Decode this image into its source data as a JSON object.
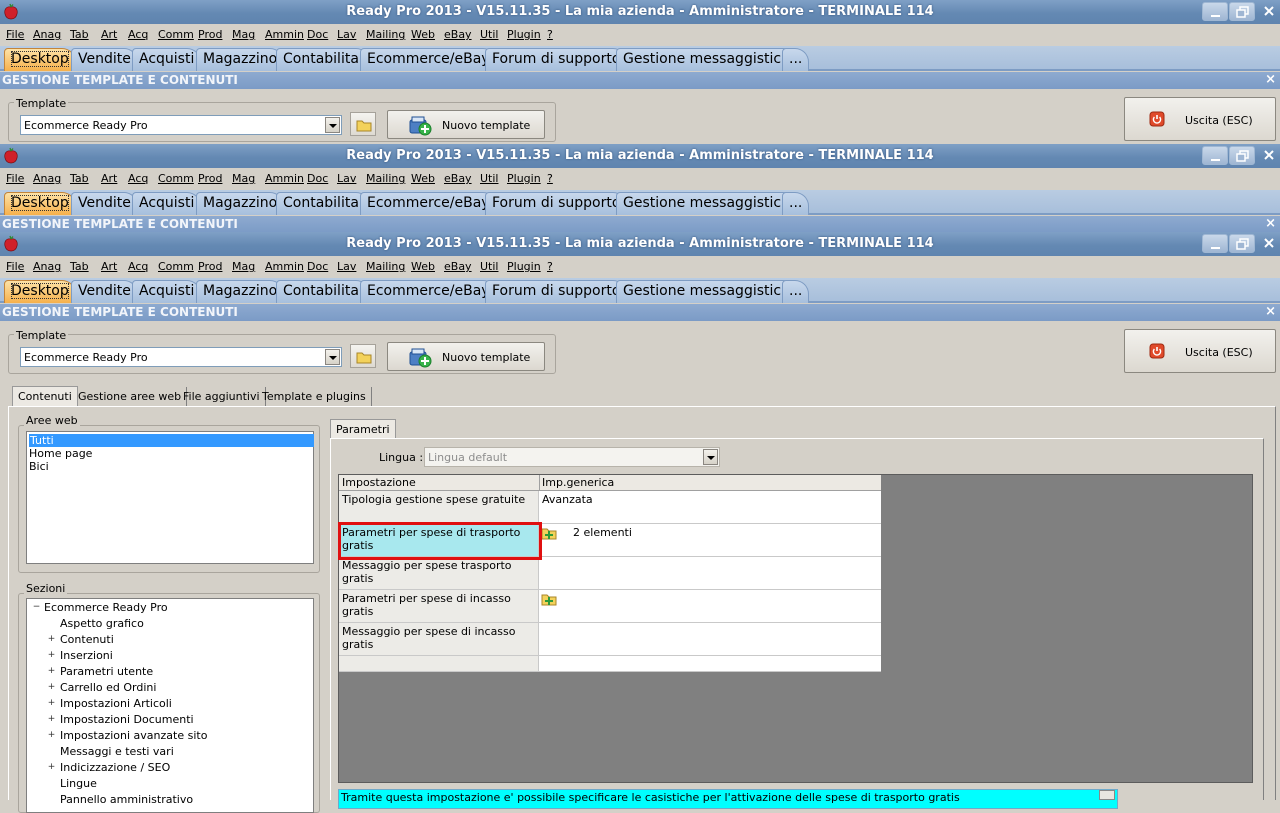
{
  "window": {
    "title": "Ready Pro 2013 - V15.11.35 - La mia azienda - Amministratore - TERMINALE 114"
  },
  "menu": [
    "File",
    "Anag",
    "Tab",
    "Art",
    "Acq",
    "Comm",
    "Prod",
    "Mag",
    "Ammin",
    "Doc",
    "Lav",
    "Mailing",
    "Web",
    "eBay",
    "Util",
    "Plugin",
    "?"
  ],
  "tabs": [
    "Desktop",
    "Vendite",
    "Acquisti",
    "Magazzino",
    "Contabilita'",
    "Ecommerce/eBay",
    "Forum di supporto",
    "Gestione messaggistica",
    "..."
  ],
  "active_tab": "Desktop",
  "section_title": "GESTIONE TEMPLATE E CONTENUTI",
  "template": {
    "label": "Template",
    "value": "Ecommerce Ready Pro",
    "new_button": "Nuovo template",
    "exit_button": "Uscita (ESC)"
  },
  "inner_tabs": [
    "Contenuti",
    "Gestione aree web",
    "File aggiuntivi",
    "Template e plugins"
  ],
  "aree_web": {
    "label": "Aree web",
    "items": [
      "Tutti",
      "Home page",
      "Bici"
    ],
    "selected": "Tutti"
  },
  "sezioni": {
    "label": "Sezioni",
    "root": "Ecommerce Ready Pro",
    "items": [
      {
        "label": "Aspetto grafico",
        "expandable": false
      },
      {
        "label": "Contenuti",
        "expandable": true
      },
      {
        "label": "Inserzioni",
        "expandable": true
      },
      {
        "label": "Parametri utente",
        "expandable": true
      },
      {
        "label": "Carrello ed Ordini",
        "expandable": true
      },
      {
        "label": "Impostazioni Articoli",
        "expandable": true
      },
      {
        "label": "Impostazioni Documenti",
        "expandable": true
      },
      {
        "label": "Impostazioni avanzate sito",
        "expandable": true
      },
      {
        "label": "Messaggi e testi vari",
        "expandable": false
      },
      {
        "label": "Indicizzazione / SEO",
        "expandable": true
      },
      {
        "label": "Lingue",
        "expandable": false
      },
      {
        "label": "Pannello amministrativo",
        "expandable": false
      }
    ]
  },
  "parametri": {
    "tab_label": "Parametri",
    "lingua_label": "Lingua :",
    "lingua_value": "Lingua default",
    "columns": [
      "Impostazione",
      "Imp.generica"
    ],
    "rows": [
      {
        "setting": "Tipologia gestione spese gratuite",
        "value": "Avanzata",
        "icon": false
      },
      {
        "setting": "Parametri per spese di trasporto gratis",
        "value": "2 elementi",
        "icon": true
      },
      {
        "setting": "Messaggio per spese trasporto gratis",
        "value": "",
        "icon": false
      },
      {
        "setting": "Parametri per spese di incasso gratis",
        "value": "",
        "icon": true
      },
      {
        "setting": "Messaggio per spese di incasso gratis",
        "value": "",
        "icon": false
      }
    ],
    "highlighted_row": 1,
    "info_text": "Tramite questa impostazione e' possibile specificare le casistiche per l'attivazione delle spese di trasporto gratis"
  },
  "colors": {
    "title_bar": "#6489b3",
    "tab_active": "#f6b04b",
    "tab_inactive": "#a6bfdd",
    "highlight_cell": "#a8e8ee",
    "highlight_border": "#e01010",
    "selection": "#3399ff",
    "info_bar": "#00ffff"
  },
  "icons": [
    "app-logo-icon",
    "minimize-icon",
    "restore-icon",
    "close-icon",
    "folder-icon",
    "new-template-icon",
    "exit-power-icon",
    "dropdown-arrow-icon",
    "edit-folder-icon"
  ]
}
